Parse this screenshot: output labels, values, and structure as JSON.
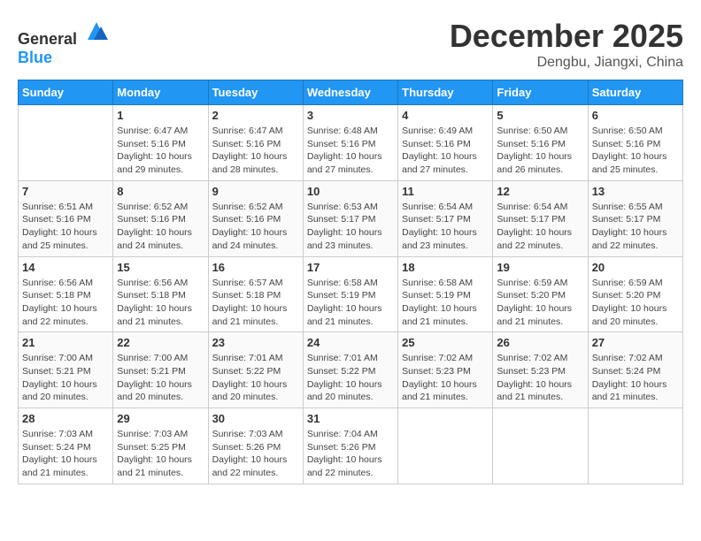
{
  "header": {
    "logo_general": "General",
    "logo_blue": "Blue",
    "month_year": "December 2025",
    "location": "Dengbu, Jiangxi, China"
  },
  "weekdays": [
    "Sunday",
    "Monday",
    "Tuesday",
    "Wednesday",
    "Thursday",
    "Friday",
    "Saturday"
  ],
  "weeks": [
    [
      {
        "day": "",
        "info": ""
      },
      {
        "day": "1",
        "info": "Sunrise: 6:47 AM\nSunset: 5:16 PM\nDaylight: 10 hours\nand 29 minutes."
      },
      {
        "day": "2",
        "info": "Sunrise: 6:47 AM\nSunset: 5:16 PM\nDaylight: 10 hours\nand 28 minutes."
      },
      {
        "day": "3",
        "info": "Sunrise: 6:48 AM\nSunset: 5:16 PM\nDaylight: 10 hours\nand 27 minutes."
      },
      {
        "day": "4",
        "info": "Sunrise: 6:49 AM\nSunset: 5:16 PM\nDaylight: 10 hours\nand 27 minutes."
      },
      {
        "day": "5",
        "info": "Sunrise: 6:50 AM\nSunset: 5:16 PM\nDaylight: 10 hours\nand 26 minutes."
      },
      {
        "day": "6",
        "info": "Sunrise: 6:50 AM\nSunset: 5:16 PM\nDaylight: 10 hours\nand 25 minutes."
      }
    ],
    [
      {
        "day": "7",
        "info": "Sunrise: 6:51 AM\nSunset: 5:16 PM\nDaylight: 10 hours\nand 25 minutes."
      },
      {
        "day": "8",
        "info": "Sunrise: 6:52 AM\nSunset: 5:16 PM\nDaylight: 10 hours\nand 24 minutes."
      },
      {
        "day": "9",
        "info": "Sunrise: 6:52 AM\nSunset: 5:16 PM\nDaylight: 10 hours\nand 24 minutes."
      },
      {
        "day": "10",
        "info": "Sunrise: 6:53 AM\nSunset: 5:17 PM\nDaylight: 10 hours\nand 23 minutes."
      },
      {
        "day": "11",
        "info": "Sunrise: 6:54 AM\nSunset: 5:17 PM\nDaylight: 10 hours\nand 23 minutes."
      },
      {
        "day": "12",
        "info": "Sunrise: 6:54 AM\nSunset: 5:17 PM\nDaylight: 10 hours\nand 22 minutes."
      },
      {
        "day": "13",
        "info": "Sunrise: 6:55 AM\nSunset: 5:17 PM\nDaylight: 10 hours\nand 22 minutes."
      }
    ],
    [
      {
        "day": "14",
        "info": "Sunrise: 6:56 AM\nSunset: 5:18 PM\nDaylight: 10 hours\nand 22 minutes."
      },
      {
        "day": "15",
        "info": "Sunrise: 6:56 AM\nSunset: 5:18 PM\nDaylight: 10 hours\nand 21 minutes."
      },
      {
        "day": "16",
        "info": "Sunrise: 6:57 AM\nSunset: 5:18 PM\nDaylight: 10 hours\nand 21 minutes."
      },
      {
        "day": "17",
        "info": "Sunrise: 6:58 AM\nSunset: 5:19 PM\nDaylight: 10 hours\nand 21 minutes."
      },
      {
        "day": "18",
        "info": "Sunrise: 6:58 AM\nSunset: 5:19 PM\nDaylight: 10 hours\nand 21 minutes."
      },
      {
        "day": "19",
        "info": "Sunrise: 6:59 AM\nSunset: 5:20 PM\nDaylight: 10 hours\nand 21 minutes."
      },
      {
        "day": "20",
        "info": "Sunrise: 6:59 AM\nSunset: 5:20 PM\nDaylight: 10 hours\nand 20 minutes."
      }
    ],
    [
      {
        "day": "21",
        "info": "Sunrise: 7:00 AM\nSunset: 5:21 PM\nDaylight: 10 hours\nand 20 minutes."
      },
      {
        "day": "22",
        "info": "Sunrise: 7:00 AM\nSunset: 5:21 PM\nDaylight: 10 hours\nand 20 minutes."
      },
      {
        "day": "23",
        "info": "Sunrise: 7:01 AM\nSunset: 5:22 PM\nDaylight: 10 hours\nand 20 minutes."
      },
      {
        "day": "24",
        "info": "Sunrise: 7:01 AM\nSunset: 5:22 PM\nDaylight: 10 hours\nand 20 minutes."
      },
      {
        "day": "25",
        "info": "Sunrise: 7:02 AM\nSunset: 5:23 PM\nDaylight: 10 hours\nand 21 minutes."
      },
      {
        "day": "26",
        "info": "Sunrise: 7:02 AM\nSunset: 5:23 PM\nDaylight: 10 hours\nand 21 minutes."
      },
      {
        "day": "27",
        "info": "Sunrise: 7:02 AM\nSunset: 5:24 PM\nDaylight: 10 hours\nand 21 minutes."
      }
    ],
    [
      {
        "day": "28",
        "info": "Sunrise: 7:03 AM\nSunset: 5:24 PM\nDaylight: 10 hours\nand 21 minutes."
      },
      {
        "day": "29",
        "info": "Sunrise: 7:03 AM\nSunset: 5:25 PM\nDaylight: 10 hours\nand 21 minutes."
      },
      {
        "day": "30",
        "info": "Sunrise: 7:03 AM\nSunset: 5:26 PM\nDaylight: 10 hours\nand 22 minutes."
      },
      {
        "day": "31",
        "info": "Sunrise: 7:04 AM\nSunset: 5:26 PM\nDaylight: 10 hours\nand 22 minutes."
      },
      {
        "day": "",
        "info": ""
      },
      {
        "day": "",
        "info": ""
      },
      {
        "day": "",
        "info": ""
      }
    ]
  ]
}
